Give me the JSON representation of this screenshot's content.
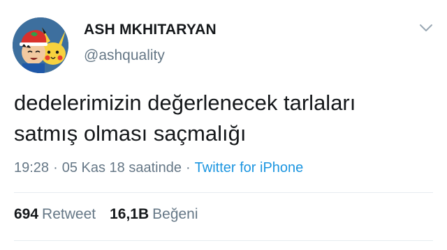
{
  "user": {
    "display_name": "ASH MKHITARYAN",
    "handle": "@ashquality"
  },
  "tweet": {
    "text_line1": "dedelerimizin değerlenecek tarlaları",
    "text_line2": "satmış olması saçmalığı"
  },
  "meta": {
    "time": "19:28",
    "separator": "·",
    "date": "05 Kas 18 saatinde",
    "source": "Twitter for iPhone"
  },
  "stats": {
    "retweets_count": "694",
    "retweets_label": "Retweet",
    "likes_count": "16,1B",
    "likes_label": "Beğeni"
  },
  "colors": {
    "text": "#14171a",
    "secondary": "#657786",
    "link": "#1b95e0",
    "divider": "#e6ecf0"
  },
  "icons": {
    "menu": "chevron-down-icon"
  }
}
